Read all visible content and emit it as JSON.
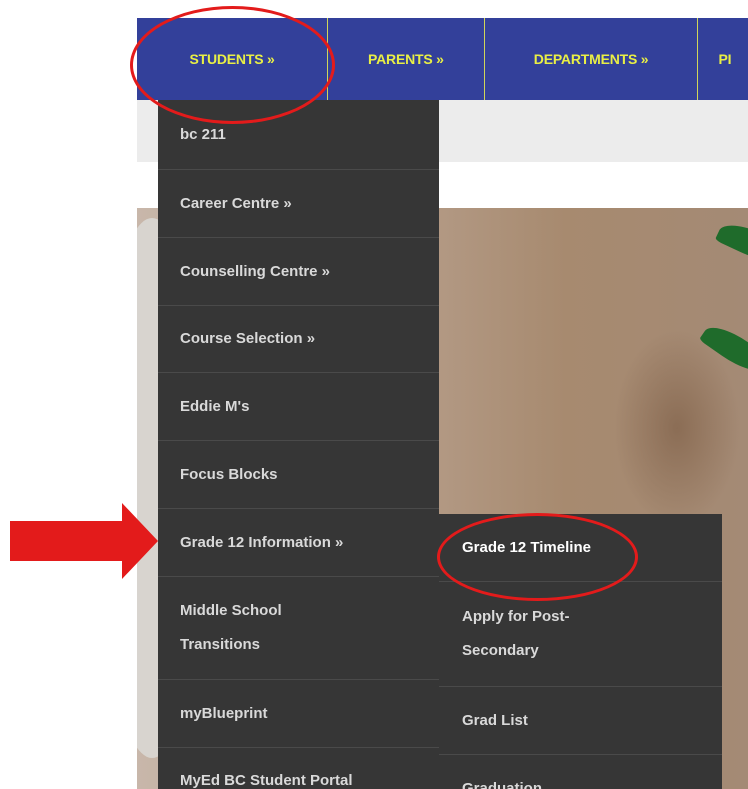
{
  "nav": {
    "items": [
      {
        "label": "STUDENTS »"
      },
      {
        "label": "PARENTS »"
      },
      {
        "label": "DEPARTMENTS »"
      },
      {
        "label": "PI"
      }
    ]
  },
  "menu": {
    "items": [
      {
        "label": "bc 211"
      },
      {
        "label": "Career Centre »"
      },
      {
        "label": "Counselling Centre »"
      },
      {
        "label": "Course Selection »"
      },
      {
        "label": "Eddie M's"
      },
      {
        "label": "Focus Blocks"
      },
      {
        "label": "Grade 12 Information »"
      },
      {
        "line1": "Middle School",
        "line2": "Transitions"
      },
      {
        "label": "myBlueprint"
      },
      {
        "label": "MyEd BC Student Portal"
      }
    ]
  },
  "submenu": {
    "items": [
      {
        "label": "Grade 12 Timeline"
      },
      {
        "line1": "Apply for Post-",
        "line2": "Secondary"
      },
      {
        "label": "Grad List"
      },
      {
        "label": "Graduation"
      }
    ]
  },
  "colors": {
    "nav_bg": "#33409a",
    "nav_text": "#e9ef45",
    "menu_bg": "#363636",
    "annotation_red": "#e31b1b"
  }
}
